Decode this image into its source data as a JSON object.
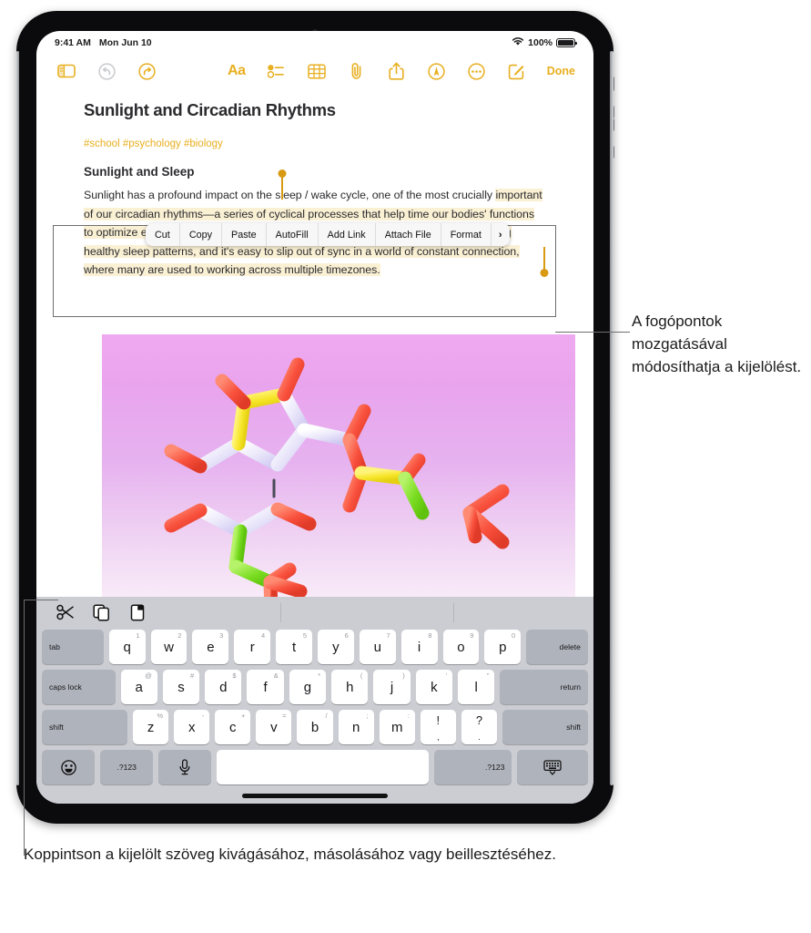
{
  "status_bar": {
    "time": "9:41 AM",
    "date": "Mon Jun 10",
    "battery_percent": "100%",
    "wifi_icon": "wifi-icon",
    "battery_icon": "battery-icon"
  },
  "toolbar": {
    "left_icons": [
      {
        "name": "sidebar-icon",
        "state": "active"
      },
      {
        "name": "undo-icon",
        "state": "disabled"
      },
      {
        "name": "redo-icon",
        "state": "active"
      }
    ],
    "right_icons": [
      {
        "name": "format-aa-icon",
        "label": "Aa"
      },
      {
        "name": "checklist-icon"
      },
      {
        "name": "table-icon"
      },
      {
        "name": "attachment-paperclip-icon"
      },
      {
        "name": "share-icon"
      },
      {
        "name": "markup-pen-icon"
      },
      {
        "name": "more-options-icon"
      },
      {
        "name": "compose-new-note-icon"
      }
    ],
    "done_label": "Done",
    "accent_color": "#E8AF20"
  },
  "note": {
    "title": "Sunlight and Circadian Rhythms",
    "tags": "#school #psychology #biology",
    "subheading": "Sunlight and Sleep",
    "paragraph_lead": "Sunlight has a profound impact on the sleep / wake cycle, one of the most crucially ",
    "paragraph_selected": "important of our circadian rhythms—a series of cyclical processes that help time our bodies' functions to optimize everything from wakefulness to digestion. Consistency is key to developing healthy sleep patterns, and it's easy to slip out of sync in a world of constant connection, where many are used to working across multiple timezones.",
    "selection_highlight_color": "#FAF0D4",
    "selection_handle_color": "#D79A12",
    "attachment": {
      "name": "molecule-3d-image",
      "description": "3D ball-and-stick molecule rendering on pink gradient"
    }
  },
  "context_menu": {
    "items": [
      {
        "label": "Cut"
      },
      {
        "label": "Copy"
      },
      {
        "label": "Paste"
      },
      {
        "label": "AutoFill"
      },
      {
        "label": "Add Link"
      },
      {
        "label": "Attach File"
      },
      {
        "label": "Format"
      },
      {
        "label": "›"
      }
    ]
  },
  "keyboard": {
    "shortcut_bar": [
      {
        "name": "cut-scissors-icon"
      },
      {
        "name": "copy-icon"
      },
      {
        "name": "paste-icon"
      }
    ],
    "row1": [
      {
        "label": "tab",
        "type": "mod",
        "align": "left",
        "flex": "wide15"
      },
      {
        "label": "q",
        "alt": "1"
      },
      {
        "label": "w",
        "alt": "2"
      },
      {
        "label": "e",
        "alt": "3"
      },
      {
        "label": "r",
        "alt": "4"
      },
      {
        "label": "t",
        "alt": "5"
      },
      {
        "label": "y",
        "alt": "6"
      },
      {
        "label": "u",
        "alt": "7"
      },
      {
        "label": "i",
        "alt": "8"
      },
      {
        "label": "o",
        "alt": "9"
      },
      {
        "label": "p",
        "alt": "0"
      },
      {
        "label": "delete",
        "type": "mod",
        "align": "right",
        "flex": "wide15"
      }
    ],
    "row2": [
      {
        "label": "caps lock",
        "type": "mod",
        "align": "left",
        "flex": "wide18"
      },
      {
        "label": "a",
        "alt": "@"
      },
      {
        "label": "s",
        "alt": "#"
      },
      {
        "label": "d",
        "alt": "$"
      },
      {
        "label": "f",
        "alt": "&"
      },
      {
        "label": "g",
        "alt": "*"
      },
      {
        "label": "h",
        "alt": "("
      },
      {
        "label": "j",
        "alt": ")"
      },
      {
        "label": "k",
        "alt": "'"
      },
      {
        "label": "l",
        "alt": "”"
      },
      {
        "label": "return",
        "type": "mod",
        "align": "right",
        "flex": "wide22"
      }
    ],
    "row3": [
      {
        "label": "shift",
        "type": "mod",
        "align": "left",
        "flex": "wide22"
      },
      {
        "label": "z",
        "alt": "%"
      },
      {
        "label": "x",
        "alt": "-"
      },
      {
        "label": "c",
        "alt": "+"
      },
      {
        "label": "v",
        "alt": "="
      },
      {
        "label": "b",
        "alt": "/"
      },
      {
        "label": "n",
        "alt": ";"
      },
      {
        "label": "m",
        "alt": ":"
      },
      {
        "label": "!",
        "sub": ",",
        "dual": true
      },
      {
        "label": "?",
        "sub": ".",
        "dual": true
      },
      {
        "label": "shift",
        "type": "mod",
        "align": "right",
        "flex": "wide22"
      }
    ],
    "row4": [
      {
        "label": "☺",
        "type": "mod",
        "icon": "emoji-icon",
        "flex": "wide15"
      },
      {
        "label": ".?123",
        "type": "mod",
        "flex": "wide15"
      },
      {
        "label": "⼀",
        "type": "mod",
        "icon": "microphone-icon",
        "flex": "wide15"
      },
      {
        "label": "",
        "type": "space"
      },
      {
        "label": ".?123",
        "type": "mod",
        "align": "right",
        "flex": "wide2"
      },
      {
        "label": "⌨",
        "type": "mod",
        "icon": "hide-keyboard-icon",
        "flex": "wide2"
      }
    ]
  },
  "callouts": {
    "selection_handles": "A fogópontok mozgatásával módosíthatja a kijelölést.",
    "cut_copy_paste": "Koppintson a kijelölt szöveg kivágásához, másolásához vagy beillesztéséhez."
  }
}
